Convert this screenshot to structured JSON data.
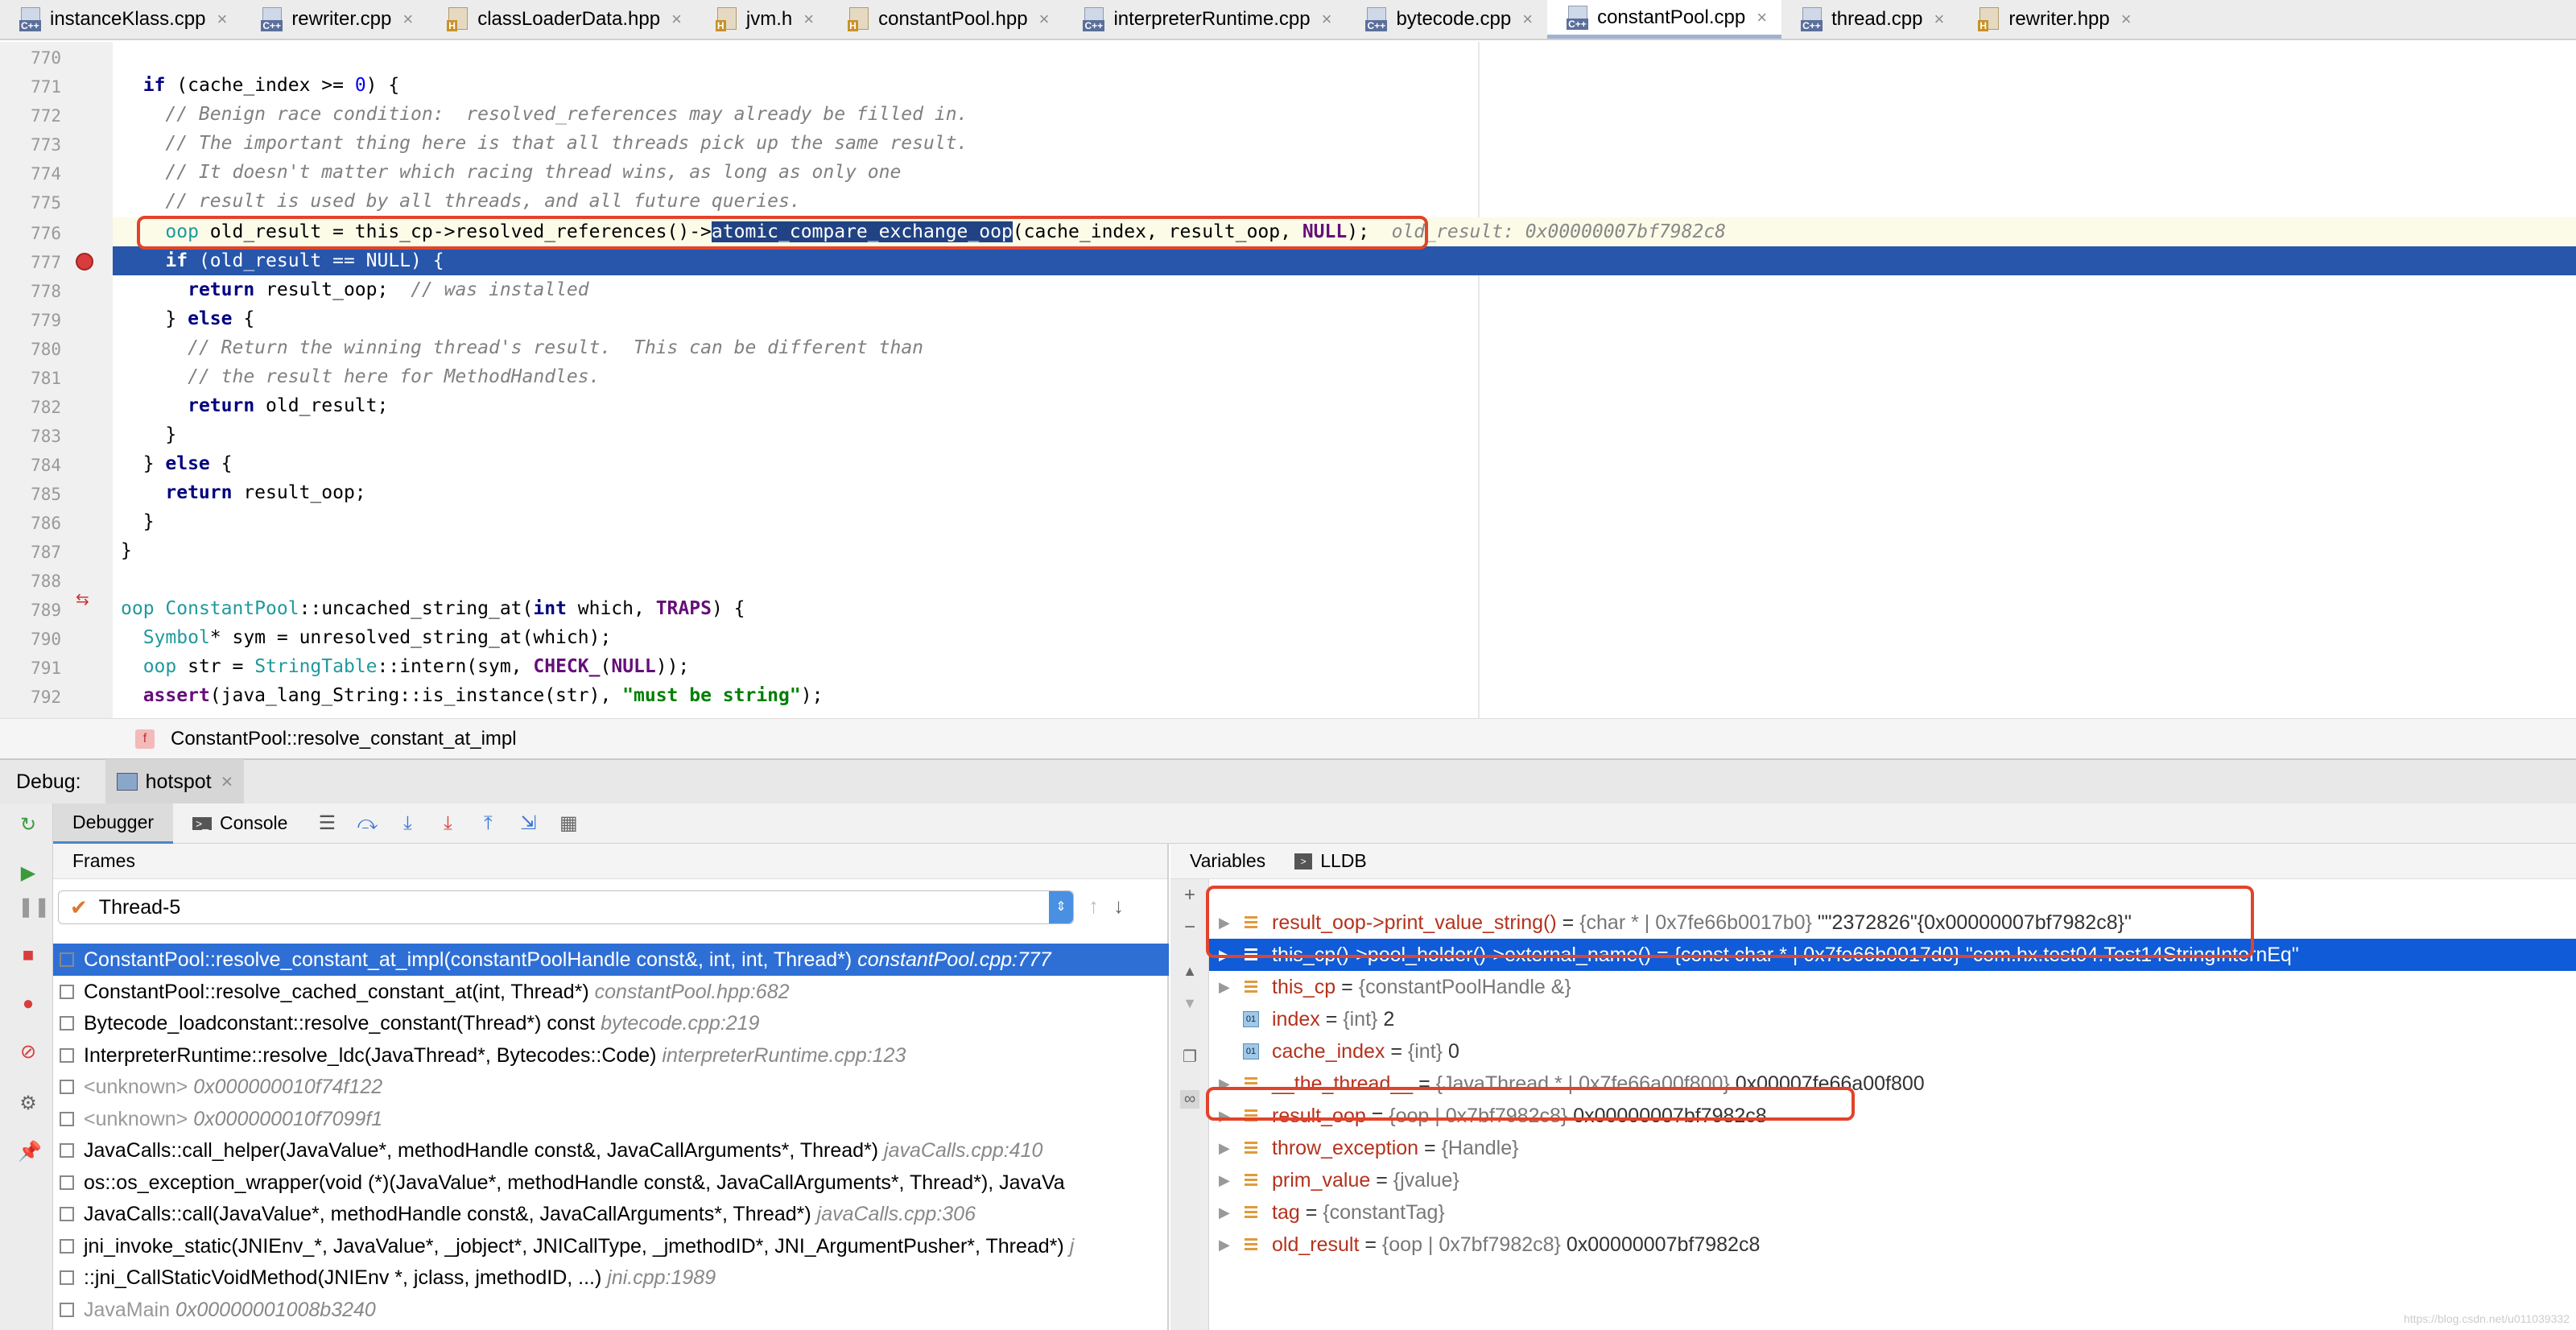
{
  "tabs": [
    {
      "label": "instanceKlass.cpp",
      "icon": "cpp-file-icon",
      "icon_text": "C++",
      "active": false
    },
    {
      "label": "rewriter.cpp",
      "icon": "cpp-file-icon",
      "icon_text": "C++",
      "active": false
    },
    {
      "label": "classLoaderData.hpp",
      "icon": "header-file-icon",
      "icon_text": "H",
      "active": false
    },
    {
      "label": "jvm.h",
      "icon": "header-file-icon",
      "icon_text": "H",
      "active": false
    },
    {
      "label": "constantPool.hpp",
      "icon": "header-file-icon",
      "icon_text": "H",
      "active": false
    },
    {
      "label": "interpreterRuntime.cpp",
      "icon": "cpp-file-icon",
      "icon_text": "C++",
      "active": false
    },
    {
      "label": "bytecode.cpp",
      "icon": "cpp-file-icon",
      "icon_text": "C++",
      "active": false
    },
    {
      "label": "constantPool.cpp",
      "icon": "cpp-file-icon",
      "icon_text": "C++",
      "active": true
    },
    {
      "label": "thread.cpp",
      "icon": "cpp-file-icon",
      "icon_text": "C++",
      "active": false
    },
    {
      "label": "rewriter.hpp",
      "icon": "header-file-icon",
      "icon_text": "H",
      "active": false
    }
  ],
  "editor": {
    "line_numbers": [
      "770",
      "771",
      "772",
      "773",
      "774",
      "775",
      "776",
      "777",
      "778",
      "779",
      "780",
      "781",
      "782",
      "783",
      "784",
      "785",
      "786",
      "787",
      "788",
      "789",
      "790",
      "791",
      "792"
    ],
    "inline_value": "old_result: 0x00000007bf7982c8",
    "breadcrumb": "ConstantPool::resolve_constant_at_impl",
    "breadcrumb_icon": "f"
  },
  "debug": {
    "label": "Debug:",
    "session": "hotspot",
    "tabs": {
      "debugger": "Debugger",
      "console": "Console"
    },
    "frames_header": "Frames",
    "thread": "Thread-5",
    "frames": [
      {
        "fn": "ConstantPool::resolve_constant_at_impl(constantPoolHandle const&, int, int, Thread*)",
        "loc": "constantPool.cpp:777",
        "selected": true
      },
      {
        "fn": "ConstantPool::resolve_cached_constant_at(int, Thread*)",
        "loc": "constantPool.hpp:682"
      },
      {
        "fn": "Bytecode_loadconstant::resolve_constant(Thread*) const",
        "loc": "bytecode.cpp:219"
      },
      {
        "fn": "InterpreterRuntime::resolve_ldc(JavaThread*, Bytecodes::Code)",
        "loc": "interpreterRuntime.cpp:123"
      },
      {
        "fn": "<unknown>",
        "loc": "0x000000010f74f122",
        "dim": true
      },
      {
        "fn": "<unknown>",
        "loc": "0x000000010f7099f1",
        "dim": true
      },
      {
        "fn": "JavaCalls::call_helper(JavaValue*, methodHandle const&, JavaCallArguments*, Thread*)",
        "loc": "javaCalls.cpp:410"
      },
      {
        "fn": "os::os_exception_wrapper(void (*)(JavaValue*, methodHandle const&, JavaCallArguments*, Thread*), JavaVa",
        "loc": ""
      },
      {
        "fn": "JavaCalls::call(JavaValue*, methodHandle const&, JavaCallArguments*, Thread*)",
        "loc": "javaCalls.cpp:306"
      },
      {
        "fn": "jni_invoke_static(JNIEnv_*, JavaValue*, _jobject*, JNICallType, _jmethodID*, JNI_ArgumentPusher*, Thread*)",
        "loc": "j"
      },
      {
        "fn": "::jni_CallStaticVoidMethod(JNIEnv *, jclass, jmethodID, ...)",
        "loc": "jni.cpp:1989"
      },
      {
        "fn": "JavaMain",
        "loc": "0x00000001008b3240",
        "dim": true
      }
    ],
    "vars_header": "Variables",
    "lldb_label": "LLDB",
    "variables": [
      {
        "name": "result_oop->print_value_string()",
        "type": "{char * | 0x7fe66b0017b0}",
        "value": "\"\"2372826\"{0x00000007bf7982c8}\"",
        "expand": "collapsed",
        "icon": "field-icon"
      },
      {
        "name": "this_cp()->pool_holder()->external_name()",
        "type": "{const char * | 0x7fe66b0017d0}",
        "value": "\"com.hx.test04.Test14StringInternEq\"",
        "expand": "expanded",
        "icon": "field-icon",
        "selected": true
      },
      {
        "name": "this_cp",
        "type": "{constantPoolHandle &}",
        "value": "",
        "expand": "collapsed",
        "icon": "field-icon"
      },
      {
        "name": "index",
        "type": "{int}",
        "value": "2",
        "expand": "none",
        "icon": "primitive-icon"
      },
      {
        "name": "cache_index",
        "type": "{int}",
        "value": "0",
        "expand": "none",
        "icon": "primitive-icon"
      },
      {
        "name": "__the_thread__",
        "type": "{JavaThread * | 0x7fe66a00f800}",
        "value": "0x00007fe66a00f800",
        "expand": "collapsed",
        "icon": "field-icon"
      },
      {
        "name": "result_oop",
        "type": "{oop | 0x7bf7982c8}",
        "value": "0x00000007bf7982c8",
        "expand": "collapsed",
        "icon": "field-icon"
      },
      {
        "name": "throw_exception",
        "type": "{Handle}",
        "value": "",
        "expand": "collapsed",
        "icon": "field-icon"
      },
      {
        "name": "prim_value",
        "type": "{jvalue}",
        "value": "",
        "expand": "collapsed",
        "icon": "field-icon"
      },
      {
        "name": "tag",
        "type": "{constantTag}",
        "value": "",
        "expand": "collapsed",
        "icon": "field-icon"
      },
      {
        "name": "old_result",
        "type": "{oop | 0x7bf7982c8}",
        "value": "0x00000007bf7982c8",
        "expand": "collapsed",
        "icon": "field-icon"
      }
    ]
  },
  "watermark": "https://blog.csdn.net/u011039332"
}
